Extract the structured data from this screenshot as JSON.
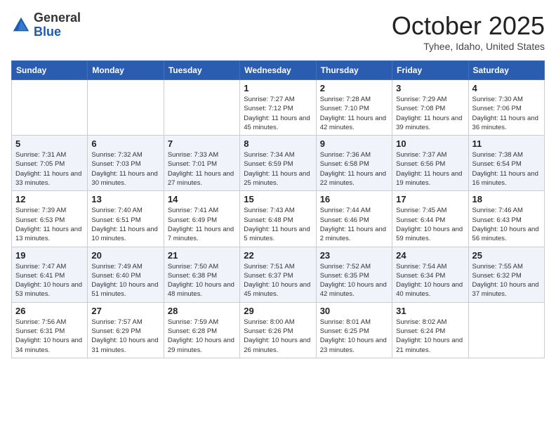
{
  "header": {
    "logo_line1": "General",
    "logo_line2": "Blue",
    "month": "October 2025",
    "location": "Tyhee, Idaho, United States"
  },
  "days_of_week": [
    "Sunday",
    "Monday",
    "Tuesday",
    "Wednesday",
    "Thursday",
    "Friday",
    "Saturday"
  ],
  "weeks": [
    [
      {
        "day": "",
        "info": ""
      },
      {
        "day": "",
        "info": ""
      },
      {
        "day": "",
        "info": ""
      },
      {
        "day": "1",
        "info": "Sunrise: 7:27 AM\nSunset: 7:12 PM\nDaylight: 11 hours and 45 minutes."
      },
      {
        "day": "2",
        "info": "Sunrise: 7:28 AM\nSunset: 7:10 PM\nDaylight: 11 hours and 42 minutes."
      },
      {
        "day": "3",
        "info": "Sunrise: 7:29 AM\nSunset: 7:08 PM\nDaylight: 11 hours and 39 minutes."
      },
      {
        "day": "4",
        "info": "Sunrise: 7:30 AM\nSunset: 7:06 PM\nDaylight: 11 hours and 36 minutes."
      }
    ],
    [
      {
        "day": "5",
        "info": "Sunrise: 7:31 AM\nSunset: 7:05 PM\nDaylight: 11 hours and 33 minutes."
      },
      {
        "day": "6",
        "info": "Sunrise: 7:32 AM\nSunset: 7:03 PM\nDaylight: 11 hours and 30 minutes."
      },
      {
        "day": "7",
        "info": "Sunrise: 7:33 AM\nSunset: 7:01 PM\nDaylight: 11 hours and 27 minutes."
      },
      {
        "day": "8",
        "info": "Sunrise: 7:34 AM\nSunset: 6:59 PM\nDaylight: 11 hours and 25 minutes."
      },
      {
        "day": "9",
        "info": "Sunrise: 7:36 AM\nSunset: 6:58 PM\nDaylight: 11 hours and 22 minutes."
      },
      {
        "day": "10",
        "info": "Sunrise: 7:37 AM\nSunset: 6:56 PM\nDaylight: 11 hours and 19 minutes."
      },
      {
        "day": "11",
        "info": "Sunrise: 7:38 AM\nSunset: 6:54 PM\nDaylight: 11 hours and 16 minutes."
      }
    ],
    [
      {
        "day": "12",
        "info": "Sunrise: 7:39 AM\nSunset: 6:53 PM\nDaylight: 11 hours and 13 minutes."
      },
      {
        "day": "13",
        "info": "Sunrise: 7:40 AM\nSunset: 6:51 PM\nDaylight: 11 hours and 10 minutes."
      },
      {
        "day": "14",
        "info": "Sunrise: 7:41 AM\nSunset: 6:49 PM\nDaylight: 11 hours and 7 minutes."
      },
      {
        "day": "15",
        "info": "Sunrise: 7:43 AM\nSunset: 6:48 PM\nDaylight: 11 hours and 5 minutes."
      },
      {
        "day": "16",
        "info": "Sunrise: 7:44 AM\nSunset: 6:46 PM\nDaylight: 11 hours and 2 minutes."
      },
      {
        "day": "17",
        "info": "Sunrise: 7:45 AM\nSunset: 6:44 PM\nDaylight: 10 hours and 59 minutes."
      },
      {
        "day": "18",
        "info": "Sunrise: 7:46 AM\nSunset: 6:43 PM\nDaylight: 10 hours and 56 minutes."
      }
    ],
    [
      {
        "day": "19",
        "info": "Sunrise: 7:47 AM\nSunset: 6:41 PM\nDaylight: 10 hours and 53 minutes."
      },
      {
        "day": "20",
        "info": "Sunrise: 7:49 AM\nSunset: 6:40 PM\nDaylight: 10 hours and 51 minutes."
      },
      {
        "day": "21",
        "info": "Sunrise: 7:50 AM\nSunset: 6:38 PM\nDaylight: 10 hours and 48 minutes."
      },
      {
        "day": "22",
        "info": "Sunrise: 7:51 AM\nSunset: 6:37 PM\nDaylight: 10 hours and 45 minutes."
      },
      {
        "day": "23",
        "info": "Sunrise: 7:52 AM\nSunset: 6:35 PM\nDaylight: 10 hours and 42 minutes."
      },
      {
        "day": "24",
        "info": "Sunrise: 7:54 AM\nSunset: 6:34 PM\nDaylight: 10 hours and 40 minutes."
      },
      {
        "day": "25",
        "info": "Sunrise: 7:55 AM\nSunset: 6:32 PM\nDaylight: 10 hours and 37 minutes."
      }
    ],
    [
      {
        "day": "26",
        "info": "Sunrise: 7:56 AM\nSunset: 6:31 PM\nDaylight: 10 hours and 34 minutes."
      },
      {
        "day": "27",
        "info": "Sunrise: 7:57 AM\nSunset: 6:29 PM\nDaylight: 10 hours and 31 minutes."
      },
      {
        "day": "28",
        "info": "Sunrise: 7:59 AM\nSunset: 6:28 PM\nDaylight: 10 hours and 29 minutes."
      },
      {
        "day": "29",
        "info": "Sunrise: 8:00 AM\nSunset: 6:26 PM\nDaylight: 10 hours and 26 minutes."
      },
      {
        "day": "30",
        "info": "Sunrise: 8:01 AM\nSunset: 6:25 PM\nDaylight: 10 hours and 23 minutes."
      },
      {
        "day": "31",
        "info": "Sunrise: 8:02 AM\nSunset: 6:24 PM\nDaylight: 10 hours and 21 minutes."
      },
      {
        "day": "",
        "info": ""
      }
    ]
  ]
}
